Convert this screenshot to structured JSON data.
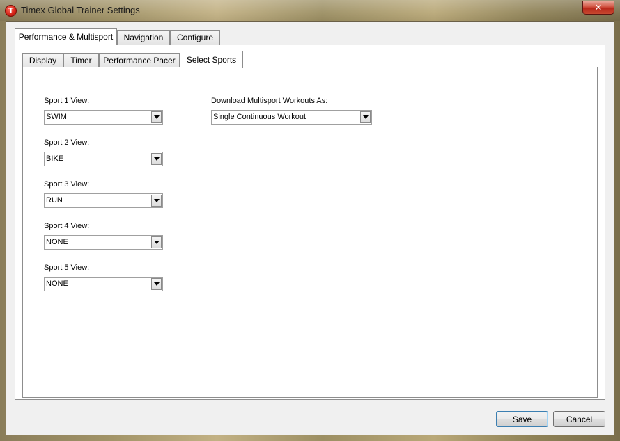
{
  "window": {
    "title": "Timex Global Trainer Settings",
    "icon_letter": "T",
    "close_symbol": "✕"
  },
  "outer_tabs": [
    {
      "label": "Performance & Multisport",
      "active": true
    },
    {
      "label": "Navigation",
      "active": false
    },
    {
      "label": "Configure",
      "active": false
    }
  ],
  "inner_tabs": [
    {
      "label": "Display",
      "active": false
    },
    {
      "label": "Timer",
      "active": false
    },
    {
      "label": "Performance Pacer",
      "active": false
    },
    {
      "label": "Select Sports",
      "active": true
    }
  ],
  "sports": [
    {
      "label": "Sport 1 View:",
      "value": "SWIM"
    },
    {
      "label": "Sport 2 View:",
      "value": "BIKE"
    },
    {
      "label": "Sport 3 View:",
      "value": "RUN"
    },
    {
      "label": "Sport 4 View:",
      "value": "NONE"
    },
    {
      "label": "Sport 5 View:",
      "value": "NONE"
    }
  ],
  "download": {
    "label": "Download Multisport Workouts As:",
    "value": "Single Continuous Workout"
  },
  "buttons": {
    "save": "Save",
    "cancel": "Cancel"
  },
  "colors": {
    "close_button": "#c8402c",
    "default_button_border": "#3c7fb1",
    "panel_background": "#ffffff",
    "dialog_background": "#f0f0f0"
  }
}
